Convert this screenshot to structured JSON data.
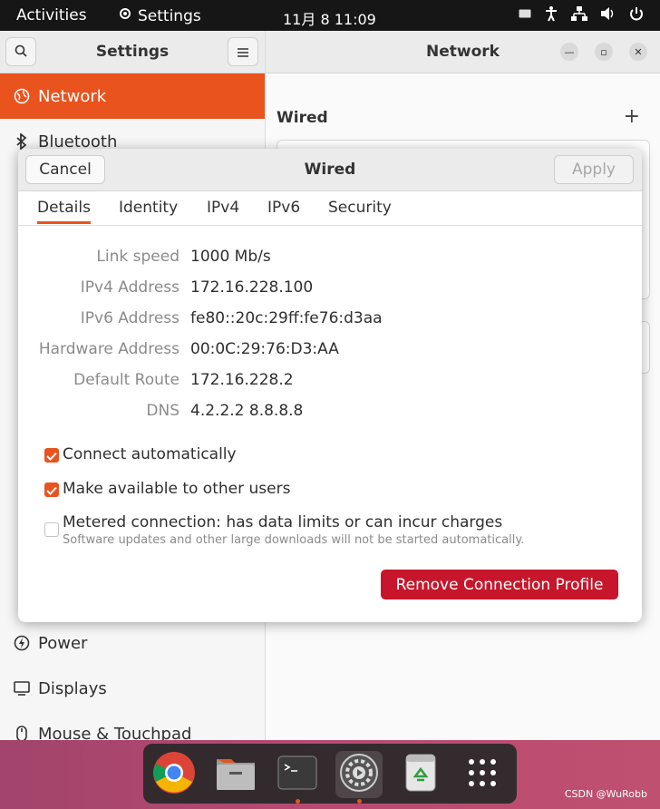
{
  "topbar": {
    "activities": "Activities",
    "app_name": "Settings",
    "clock": "11月 8  11:09"
  },
  "sidebar": {
    "title": "Settings",
    "items": [
      {
        "label": "Network",
        "icon": "network-icon"
      },
      {
        "label": "Bluetooth",
        "icon": "bluetooth-icon"
      },
      {
        "label": "Power",
        "icon": "power-icon"
      },
      {
        "label": "Displays",
        "icon": "display-icon"
      },
      {
        "label": "Mouse & Touchpad",
        "icon": "mouse-icon"
      }
    ]
  },
  "main": {
    "title": "Network",
    "section": "Wired",
    "add_symbol": "+"
  },
  "dialog": {
    "title": "Wired",
    "cancel": "Cancel",
    "apply": "Apply",
    "tabs": [
      "Details",
      "Identity",
      "IPv4",
      "IPv6",
      "Security"
    ],
    "details": [
      {
        "label": "Link speed",
        "value": "1000 Mb/s"
      },
      {
        "label": "IPv4 Address",
        "value": "172.16.228.100"
      },
      {
        "label": "IPv6 Address",
        "value": "fe80::20c:29ff:fe76:d3aa"
      },
      {
        "label": "Hardware Address",
        "value": "00:0C:29:76:D3:AA"
      },
      {
        "label": "Default Route",
        "value": "172.16.228.2"
      },
      {
        "label": "DNS",
        "value": "4.2.2.2 8.8.8.8"
      }
    ],
    "options": {
      "connect_auto": "Connect automatically",
      "available_users": "Make available to other users",
      "metered": "Metered connection: has data limits or can incur charges",
      "metered_sub": "Software updates and other large downloads will not be started automatically."
    },
    "remove": "Remove Connection Profile"
  },
  "watermark": "CSDN @WuRobb",
  "colors": {
    "accent": "#e9531e",
    "danger": "#c7162b"
  }
}
